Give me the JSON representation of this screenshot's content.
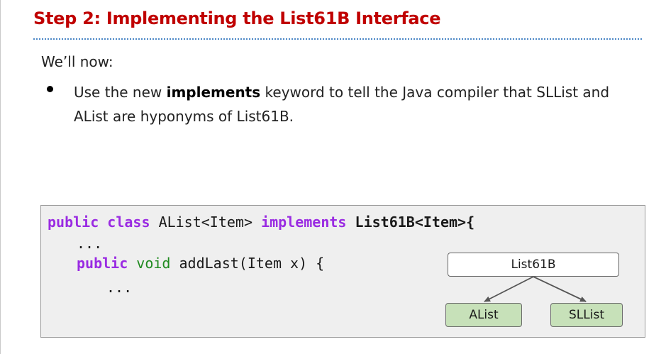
{
  "slide": {
    "title": "Step 2: Implementing the List61B Interface",
    "intro": "We’ll now:",
    "bullet": {
      "before": "Use the new ",
      "keyword": "implements",
      "after": " keyword to tell the Java compiler that SLList and AList are hyponyms of List61B."
    }
  },
  "code": {
    "line1": {
      "kw1": "public",
      "kw2": "class",
      "type": "AList<Item>",
      "kw3": "implements",
      "iface": "List61B<Item>{"
    },
    "ellipsis1": "...",
    "line3": {
      "kw1": "public",
      "kw2": "void",
      "rest": "addLast(Item x) {"
    },
    "ellipsis2": "..."
  },
  "diagram": {
    "parent": "List61B",
    "children": [
      "AList",
      "SLList"
    ]
  },
  "colors": {
    "title": "#c00000",
    "keyword": "#9a2be2",
    "type_keyword": "#1f8a1f",
    "child_box": "#c7e1b9",
    "divider": "#4a86c5"
  }
}
